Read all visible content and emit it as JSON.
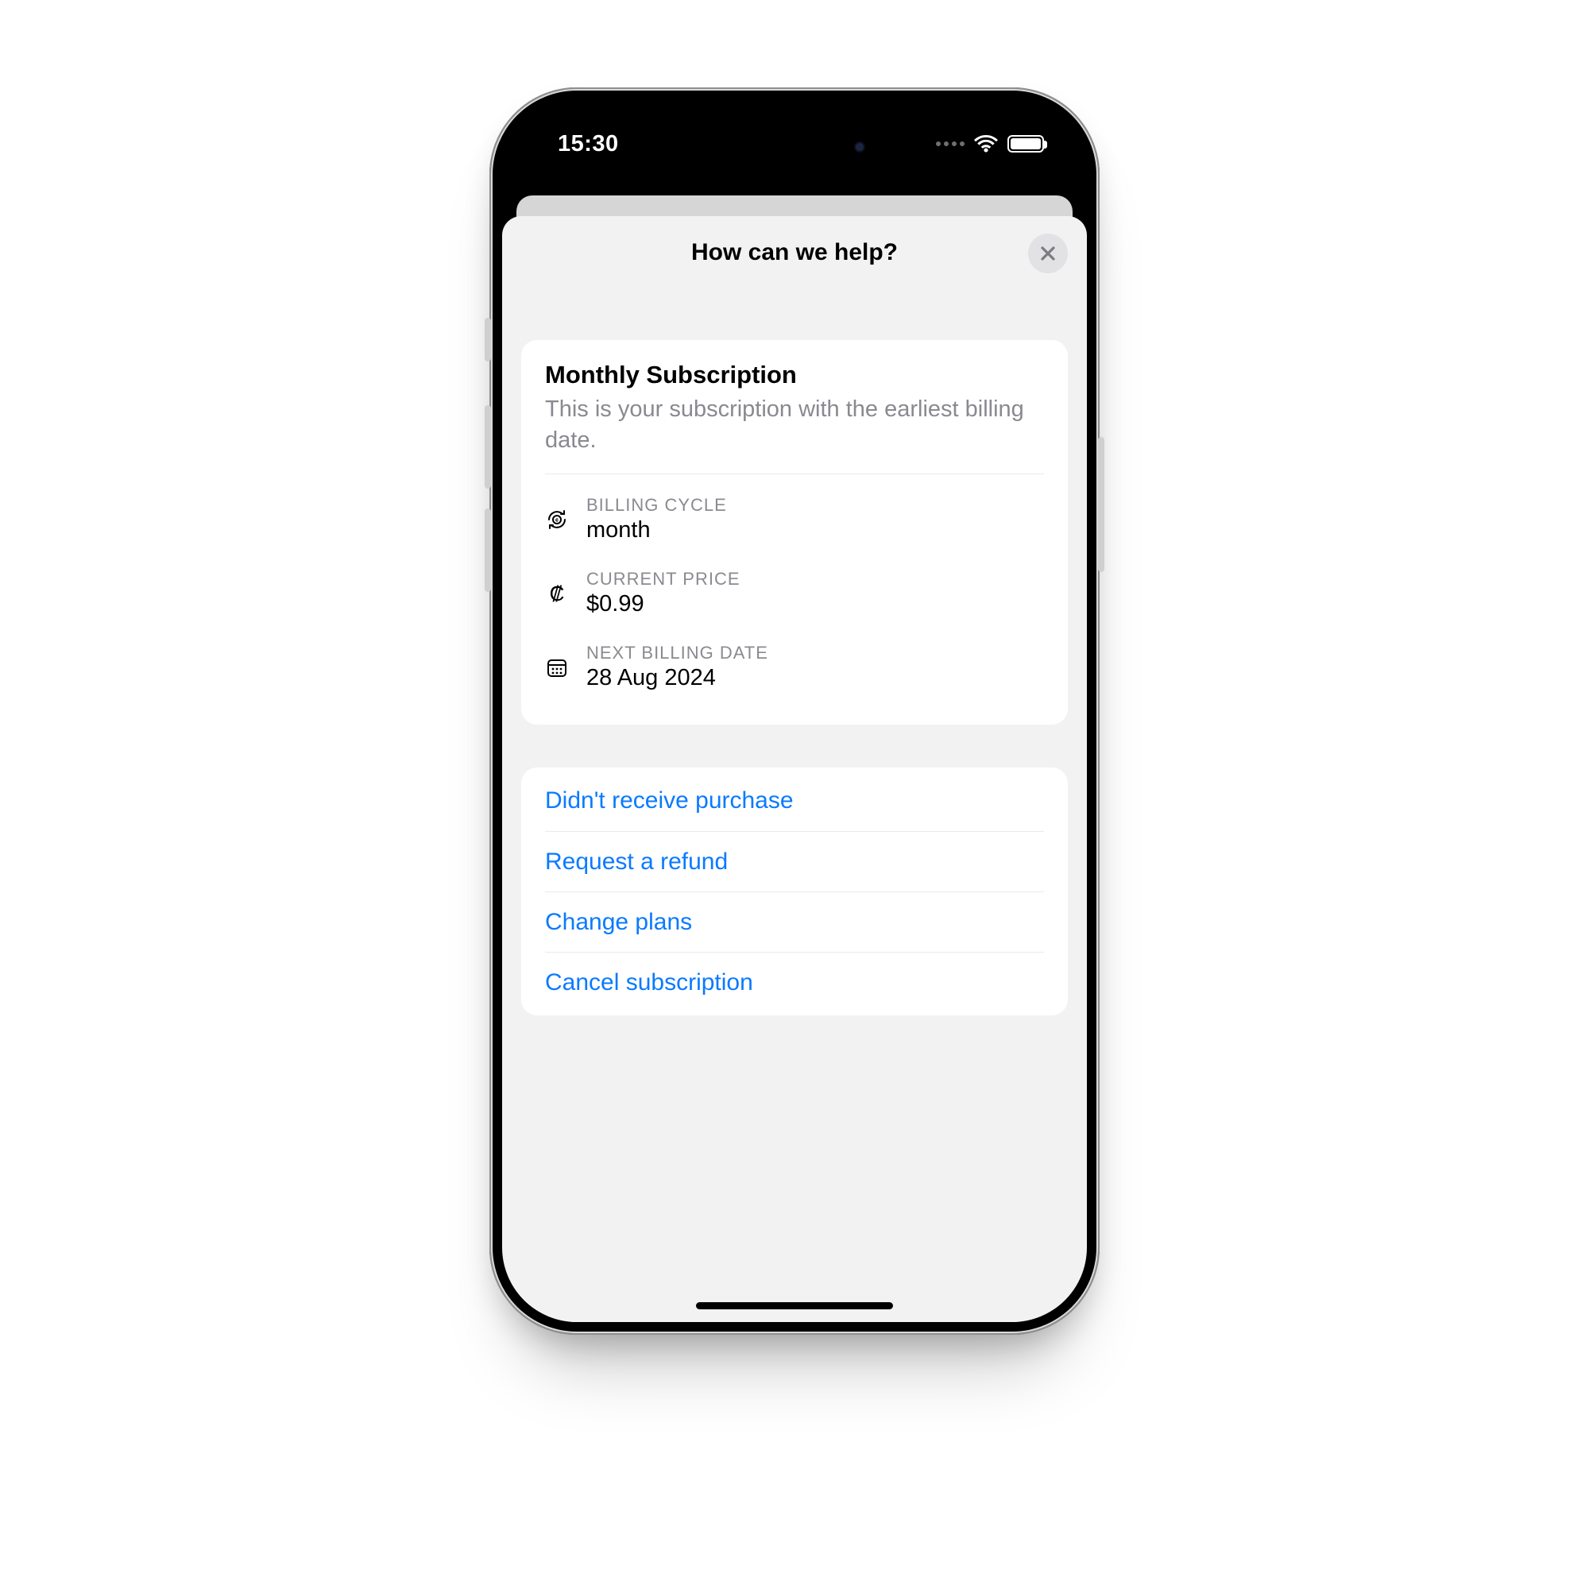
{
  "status": {
    "time": "15:30"
  },
  "sheet": {
    "title": "How can we help?"
  },
  "subscription": {
    "title": "Monthly Subscription",
    "subtitle": "This is your subscription with the earliest billing date.",
    "fields": {
      "cycle": {
        "label": "BILLING CYCLE",
        "value": "month"
      },
      "price": {
        "label": "CURRENT PRICE",
        "value": "$0.99"
      },
      "nextbill": {
        "label": "NEXT BILLING DATE",
        "value": "28 Aug 2024"
      }
    }
  },
  "actions": {
    "didnt_receive": "Didn't receive purchase",
    "refund": "Request a refund",
    "change_plans": "Change plans",
    "cancel": "Cancel subscription"
  },
  "colors": {
    "action_link": "#0a7aff"
  }
}
